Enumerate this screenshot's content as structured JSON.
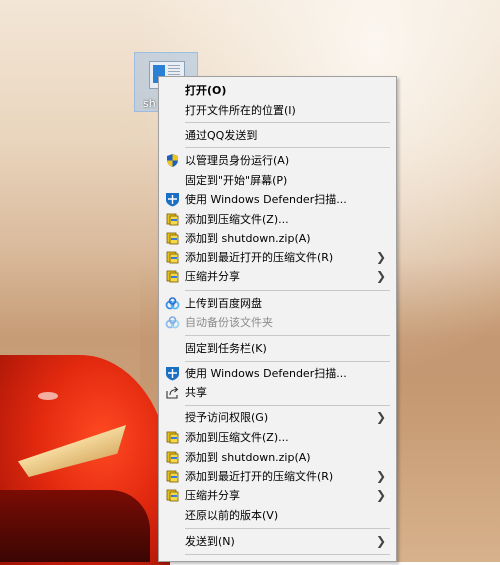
{
  "desktop": {
    "icon_label": "sh"
  },
  "menu": {
    "items": [
      {
        "label": "打开(O)"
      },
      {
        "label": "打开文件所在的位置(I)"
      },
      {
        "label": "通过QQ发送到"
      },
      {
        "label": "以管理员身份运行(A)"
      },
      {
        "label": "固定到\"开始\"屏幕(P)"
      },
      {
        "label": "使用 Windows Defender扫描..."
      },
      {
        "label": "添加到压缩文件(Z)..."
      },
      {
        "label": "添加到 shutdown.zip(A)"
      },
      {
        "label": "添加到最近打开的压缩文件(R)"
      },
      {
        "label": "压缩并分享"
      },
      {
        "label": "上传到百度网盘"
      },
      {
        "label": "自动备份该文件夹"
      },
      {
        "label": "固定到任务栏(K)"
      },
      {
        "label": "使用 Windows Defender扫描..."
      },
      {
        "label": "共享"
      },
      {
        "label": "授予访问权限(G)"
      },
      {
        "label": "添加到压缩文件(Z)..."
      },
      {
        "label": "添加到 shutdown.zip(A)"
      },
      {
        "label": "添加到最近打开的压缩文件(R)"
      },
      {
        "label": "压缩并分享"
      },
      {
        "label": "还原以前的版本(V)"
      },
      {
        "label": "发送到(N)"
      }
    ]
  },
  "colors": {
    "menu_bg": "#f2f2f2",
    "separator": "#c8c8c8",
    "disabled_text": "#8c8c8c",
    "defender_blue": "#1a6fc4",
    "winrar_yellow": "#e8c21c",
    "baidu_blue": "#3b8fe6"
  },
  "icons": {
    "admin": "uac-shield-icon",
    "defender": "windows-defender-icon",
    "archive": "winrar-icon",
    "baidu": "baidu-netdisk-icon",
    "share": "share-icon",
    "submenu": "chevron-right-icon"
  }
}
